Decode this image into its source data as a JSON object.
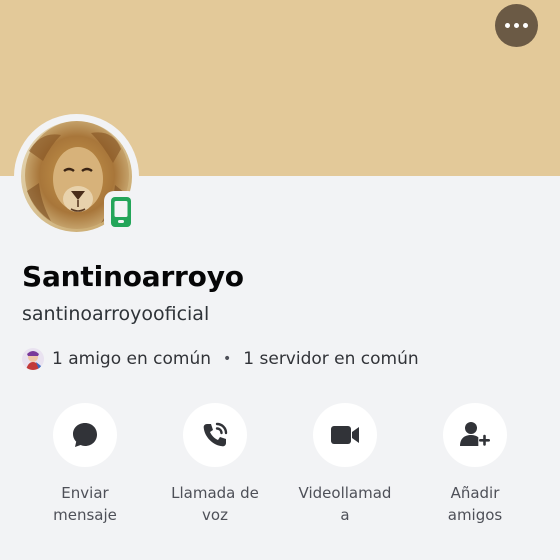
{
  "profile": {
    "banner_color": "#e3c999",
    "display_name": "Santinoarroyo",
    "username": "santinoarroyooficial",
    "avatar_icon": "lion-avatar",
    "status_icon": "mobile-online-icon",
    "status_color": "#23a559"
  },
  "mutuals": {
    "friends": "1 amigo en común",
    "separator": "•",
    "servers": "1 servidor en común"
  },
  "actions": [
    {
      "label": "Enviar mensaje",
      "icon": "chat-bubble-icon"
    },
    {
      "label": "Llamada de voz",
      "icon": "phone-call-icon"
    },
    {
      "label": "Videollamada",
      "icon": "video-camera-icon"
    },
    {
      "label": "Añadir amigos",
      "icon": "add-friend-icon"
    }
  ]
}
